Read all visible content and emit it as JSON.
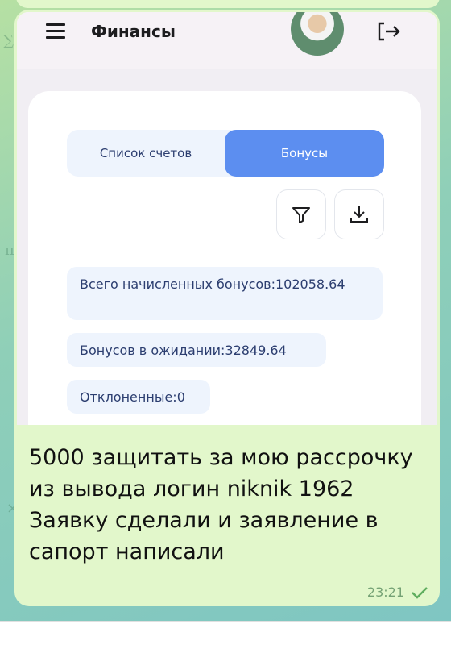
{
  "app": {
    "title": "Финансы"
  },
  "tabs": [
    {
      "label": "Список счетов",
      "active": false
    },
    {
      "label": "Бонусы",
      "active": true
    }
  ],
  "toolbar": {
    "filter_icon": "filter-icon",
    "download_icon": "download-icon"
  },
  "stats": {
    "total": "Всего начисленных бонусов:102058.64",
    "pending": "Бонусов в ожидании:32849.64",
    "rejected": "Отклоненные:0"
  },
  "message": {
    "text": "5000 защитать за мою рассрочку  из вывода логин niknik 1962\nЗаявку сделали и заявление в сапорт написали",
    "time": "23:21",
    "status_icon": "check-icon"
  },
  "colors": {
    "bubble": "#e2f7cb",
    "accent": "#5c8ef0",
    "stat_bg": "#eef4fd"
  }
}
